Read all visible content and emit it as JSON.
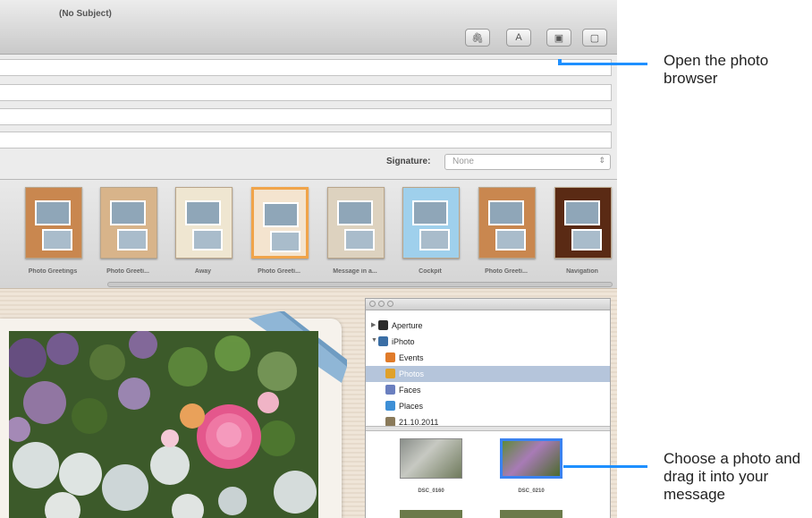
{
  "window": {
    "title": "(No Subject)"
  },
  "toolbar": {
    "buttons": [
      {
        "name": "attach-icon",
        "glyph": "🖇"
      },
      {
        "name": "fonts-icon",
        "glyph": "A"
      },
      {
        "name": "photo-browser-icon",
        "glyph": "▣"
      },
      {
        "name": "stationery-icon",
        "glyph": "▢"
      }
    ]
  },
  "signature": {
    "label": "Signature:",
    "value": "None"
  },
  "stationery": {
    "templates": [
      {
        "label": "Photo Greetings",
        "bg": "#c9874f",
        "selected": false
      },
      {
        "label": "Photo Greeti...",
        "bg": "#d8b48a",
        "selected": false
      },
      {
        "label": "Away",
        "bg": "#efe6d1",
        "selected": false
      },
      {
        "label": "Photo Greeti...",
        "bg": "#f4e4cf",
        "selected": true
      },
      {
        "label": "Message in a...",
        "bg": "#ddd2bf",
        "selected": false
      },
      {
        "label": "Cockpit",
        "bg": "#9fd0ec",
        "selected": false
      },
      {
        "label": "Photo Greeti...",
        "bg": "#c9874f",
        "selected": false
      },
      {
        "label": "Navigation",
        "bg": "#5a2a14",
        "selected": false
      }
    ]
  },
  "photo_browser": {
    "tree": [
      {
        "label": "Aperture",
        "indent": 1,
        "triangle": "▶",
        "icon": "#2b2b2b",
        "selected": false
      },
      {
        "label": "iPhoto",
        "indent": 1,
        "triangle": "▼",
        "icon": "#3a6ea5",
        "selected": false
      },
      {
        "label": "Events",
        "indent": 2,
        "triangle": "",
        "icon": "#e07b2a",
        "selected": false
      },
      {
        "label": "Photos",
        "indent": 2,
        "triangle": "",
        "icon": "#e0a12a",
        "selected": true
      },
      {
        "label": "Faces",
        "indent": 2,
        "triangle": "",
        "icon": "#6a7fbf",
        "selected": false
      },
      {
        "label": "Places",
        "indent": 2,
        "triangle": "",
        "icon": "#3d8fd6",
        "selected": false
      },
      {
        "label": "21.10.2011",
        "indent": 2,
        "triangle": "",
        "icon": "#8a7a5a",
        "selected": false
      }
    ],
    "photos": [
      {
        "label": "DSC_0160",
        "selected": false
      },
      {
        "label": "DSC_0210",
        "selected": true
      }
    ]
  },
  "callouts": {
    "photo_browser": "Open the photo browser",
    "choose_photo": "Choose a photo and drag it into your message"
  },
  "colors": {
    "accent": "#1e90ff",
    "selection": "#b5c5db",
    "rose": "#e4578c"
  }
}
